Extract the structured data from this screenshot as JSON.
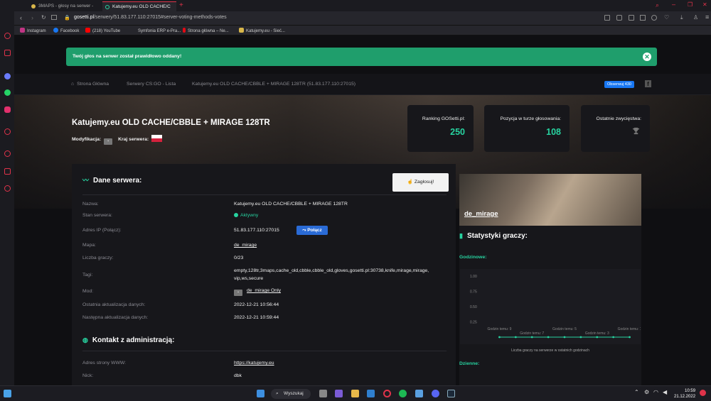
{
  "browser": {
    "tabs": [
      {
        "label": "3MAPS - głosy na serwer -",
        "active": false
      },
      {
        "label": "Katujemy.eu OLD CACHE/C",
        "active": true
      }
    ],
    "url_host": "gosetti.pl",
    "url_path": "/serwery/51.83.177.110:27015#server-voting-methods-votes",
    "bookmarks": [
      {
        "label": "Instagram",
        "color": "#c13584"
      },
      {
        "label": "Facebook",
        "color": "#1877f2"
      },
      {
        "label": "(218) YouTube",
        "color": "#ff0000"
      },
      {
        "label": "Symfonia ERP e-Pra...",
        "color": "#888888"
      },
      {
        "label": "Strona główna – Ne...",
        "color": "#e50914"
      },
      {
        "label": "Katujemy.eu - Sieć...",
        "color": "#d8b64a"
      }
    ]
  },
  "alert": {
    "text": "Twój głos na serwer został prawidłowo oddany!",
    "close": "✕"
  },
  "breadcrumb": [
    "Strona Główna",
    "Serwery CS:GO - Lista",
    "Katujemy.eu OLD CACHE/CBBLE + MIRAGE 128TR (51.83.177.110:27015)"
  ],
  "follow_label": "Obserwuj 430",
  "fb_icon": "f",
  "server": {
    "title": "Katujemy.eu OLD CACHE/CBBLE + MIRAGE 128TR",
    "mod_label": "Modyfikacja:",
    "country_label": "Kraj serwera:"
  },
  "stats": [
    {
      "label": "Ranking GOSetti.pl:",
      "value": "250"
    },
    {
      "label": "Pozycja w turze głosowania:",
      "value": "108"
    },
    {
      "label": "Ostatnie zwycięstwa:",
      "value": ""
    }
  ],
  "data_section": {
    "title": "Dane serwera:",
    "report_button": "Zagłosuj!",
    "rows": [
      {
        "label": "Nazwa:",
        "value": "Katujemy.eu OLD CACHE/CBBLE + MIRAGE 128TR"
      },
      {
        "label": "Stan serwera:",
        "value": "Aktywny"
      },
      {
        "label": "Adres IP (Połącz):",
        "value": "51.83.177.110:27015"
      },
      {
        "label": "Mapa:",
        "value": "de_mirage"
      },
      {
        "label": "Liczba graczy:",
        "value": "0/23"
      },
      {
        "label": "Tagi:",
        "value": "empty,128tr,3maps,cache_old,cbble,cbble_old,gloves,gosetti.pl:30738,knife,mirage,mirage,",
        "value2": "vip,ws,secure"
      },
      {
        "label": "Mod:",
        "value": "de_mirage Only"
      },
      {
        "label": "Ostatnia aktualizacja danych:",
        "value": "2022-12-21 10:56:44"
      },
      {
        "label": "Następna aktualizacja danych:",
        "value": "2022-12-21 10:59:44"
      }
    ],
    "connect_button": "Połącz"
  },
  "contact_section": {
    "title": "Kontakt z administracją:",
    "rows": [
      {
        "label": "Adres strony WWW:",
        "value": "https://katujemy.eu"
      },
      {
        "label": "Nick:",
        "value": "dbk"
      }
    ]
  },
  "map_card": {
    "name": "de_mirage"
  },
  "player_stats": {
    "title": "Statystyki graczy:",
    "hourly_label": "Godzinowe:",
    "daily_label": "Dzienne:",
    "caption": "Liczba graczy na serwerze w ostatnich godzinach"
  },
  "chart_data": {
    "type": "line",
    "x": [
      "Godzin temu: 9",
      "Godzin temu: 8",
      "Godzin temu: 7",
      "Godzin temu: 6",
      "Godzin temu: 5",
      "Godzin temu: 4",
      "Godzin temu: 3",
      "Godzin temu: 2",
      "Godzin temu: 1"
    ],
    "x_ticks_shown": [
      "Godzin temu: 9",
      "Godzin temu: 7",
      "Godzin temu: 5",
      "Godzin temu: 3",
      "Godzin temu: 1"
    ],
    "series": [
      {
        "values": [
          0,
          0,
          0,
          0,
          0,
          0,
          0,
          0,
          0
        ],
        "color": "#27d3a0"
      }
    ],
    "y_ticks": [
      "1.00",
      "0.75",
      "0.50",
      "0.25"
    ],
    "ylim": [
      0,
      1
    ],
    "xlabel": "",
    "ylabel": "",
    "title": ""
  },
  "taskbar": {
    "search_label": "Wyszukaj",
    "time": "10:59",
    "date": "21.12.2022"
  }
}
